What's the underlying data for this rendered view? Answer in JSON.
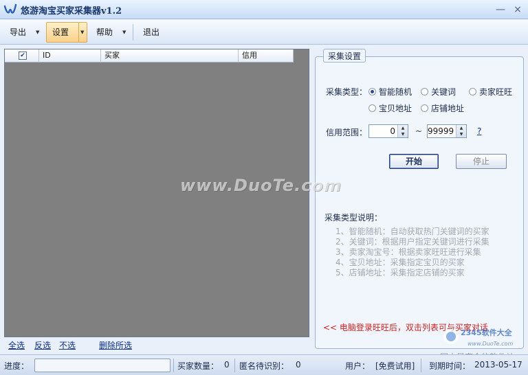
{
  "window": {
    "title": "悠游淘宝买家采集器v1.2",
    "minimize": "—",
    "close": "×"
  },
  "toolbar": {
    "export": "导出",
    "settings": "设置",
    "help": "帮助",
    "exit": "退出"
  },
  "table": {
    "columns": [
      "ID",
      "买家",
      "信用"
    ],
    "header_checkbox_checked": true,
    "rows": []
  },
  "list_actions": {
    "select_all": "全选",
    "invert": "反选",
    "select_none": "不选",
    "delete_selected": "删除所选"
  },
  "settings": {
    "title": "采集设置",
    "type_label": "采集类型：",
    "types": [
      {
        "label": "智能随机",
        "checked": true
      },
      {
        "label": "关键词",
        "checked": false
      },
      {
        "label": "卖家旺旺",
        "checked": false
      },
      {
        "label": "宝贝地址",
        "checked": false
      },
      {
        "label": "店铺地址",
        "checked": false
      }
    ],
    "credit_label": "信用范围：",
    "credit_min": "0",
    "credit_max": "99999",
    "range_sep": "~",
    "help_link": "?",
    "start": "开始",
    "stop": "停止",
    "desc_title": "采集类型说明：",
    "desc_items": [
      "1、智能随机：自动获取热门关键词的买家",
      "2、关键词：根据用户指定关键词进行采集",
      "3、卖家淘宝号：根据卖家旺旺进行采集",
      "4、宝贝地址：采集指定宝贝的买家",
      "5、店铺地址：采集指定店铺的买家"
    ],
    "tip": "<< 电脑登录旺旺后，双击列表可与买家对话"
  },
  "watermark": "www.DuoTe.com",
  "corner_brand": {
    "name": "2345软件大全",
    "url": "www.DuoTe.com",
    "slogan": "国内最安全的软件站"
  },
  "status": {
    "progress_label": "进度：",
    "progress": 0,
    "count_label": "买家数量：",
    "count": "0",
    "anon_label": "匿名待识别：",
    "anon": "0",
    "user_label": "用户：",
    "user": "[免费试用]",
    "expiry_label": "到期时间：",
    "expiry": "2013-05-17"
  },
  "colors": {
    "accent": "#fcd08a",
    "list_bg": "#808080",
    "tip": "#d11f1f",
    "link": "#0b2f8f"
  }
}
